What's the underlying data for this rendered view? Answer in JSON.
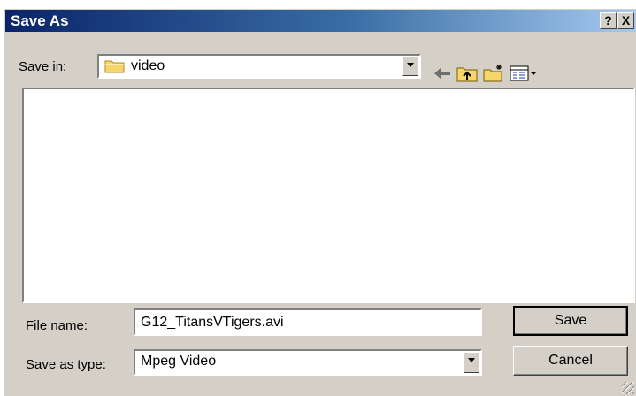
{
  "window": {
    "title": "Save As",
    "help_button": "?",
    "close_button": "X"
  },
  "toolbar": {
    "save_in_label": "Save in:",
    "save_in_value": "video",
    "back_icon": "back-arrow-icon",
    "up_icon": "up-folder-icon",
    "new_folder_icon": "new-folder-icon",
    "views_icon": "views-menu-icon"
  },
  "fields": {
    "file_name_label": "File name:",
    "file_name_value": "G12_TitansVTigers.avi",
    "type_label": "Save as type:",
    "type_value": "Mpeg Video"
  },
  "buttons": {
    "save": "Save",
    "cancel": "Cancel"
  },
  "colors": {
    "title_start": "#0a246a",
    "title_end": "#a6caf0",
    "face": "#d4d0c8"
  }
}
